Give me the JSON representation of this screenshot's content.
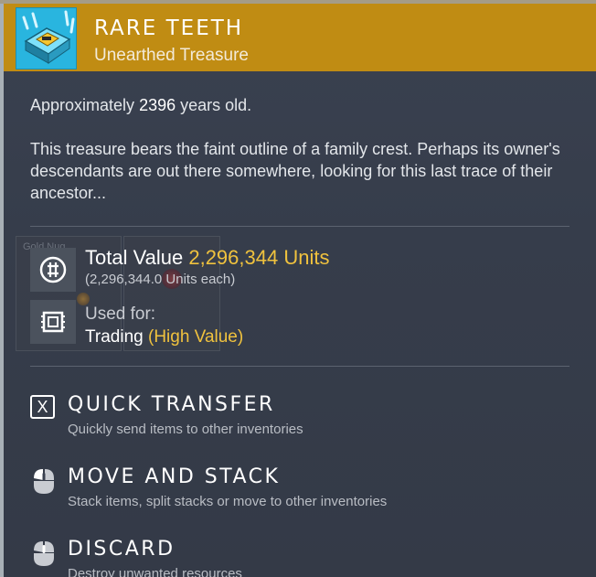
{
  "item": {
    "name": "RARE TEETH",
    "category": "Unearthed Treasure",
    "age_prefix": "Approximately ",
    "age_years": "2396",
    "age_suffix": " years old.",
    "description": "This treasure bears the faint outline of a family crest. Perhaps its owner's descendants are out there somewhere, looking for this last trace of their ancestor..."
  },
  "background_slot": {
    "label": "Gold Nug"
  },
  "value": {
    "label": "Total Value ",
    "amount": "2,296,344 Units",
    "each": "(2,296,344.0 Units each)",
    "icon": "units-currency-icon"
  },
  "usage": {
    "label": "Used for:",
    "value": "Trading ",
    "highlight": "(High Value)",
    "icon": "trading-chip-icon"
  },
  "actions": [
    {
      "key": "X",
      "title": "QUICK TRANSFER",
      "desc": "Quickly send items to other inventories",
      "icon": "x-key-icon"
    },
    {
      "title": "MOVE AND STACK",
      "desc": "Stack items, split stacks or move to other inventories",
      "icon": "left-mouse-button-icon"
    },
    {
      "title": "DISCARD",
      "desc": "Destroy unwanted resources",
      "icon": "mouse-button-icon"
    }
  ],
  "colors": {
    "header": "#c08c13",
    "panel": "#363d4b",
    "accent_value": "#f0c23e",
    "item_icon_bg": "#26b3dd"
  }
}
